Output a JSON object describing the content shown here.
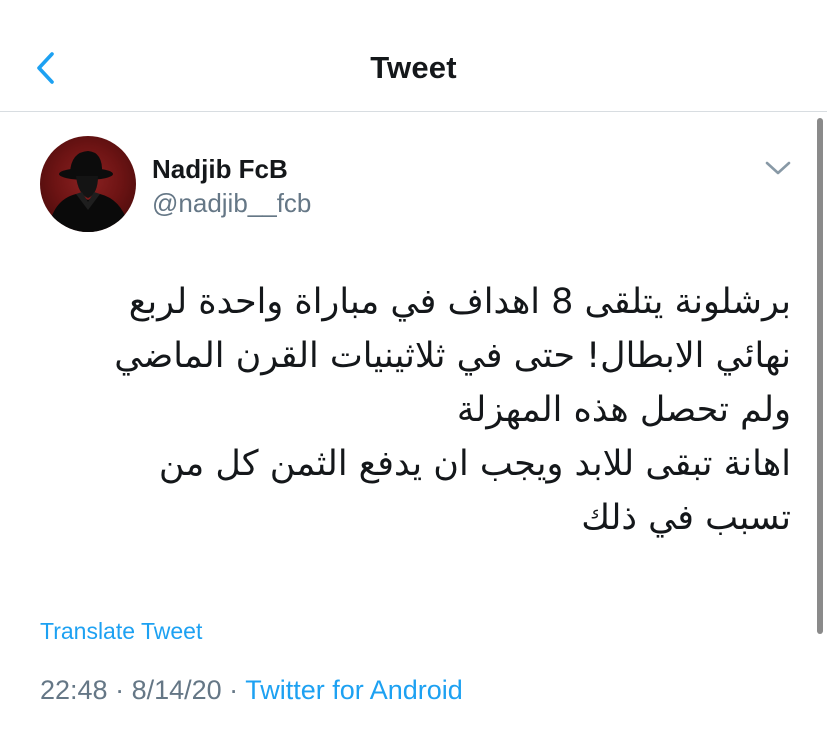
{
  "header": {
    "title": "Tweet",
    "back_icon": "chevron-left-icon",
    "accent_color": "#1da1f2"
  },
  "tweet": {
    "author": {
      "display_name": "Nadjib FcB",
      "handle": "@nadjib__fcb"
    },
    "menu_icon": "chevron-down-icon",
    "text_lines": [
      "برشلونة يتلقى 8 اهداف في مباراة واحدة لربع",
      "نهائي الابطال! حتى في ثلاثينيات القرن الماضي",
      "ولم تحصل هذه المهزلة",
      "اهانة تبقى للابد ويجب ان يدفع الثمن كل من",
      "تسبب في ذلك"
    ],
    "translate_label": "Translate Tweet",
    "time": "22:48",
    "date": "8/14/20",
    "separator": " · ",
    "source": "Twitter for Android"
  }
}
